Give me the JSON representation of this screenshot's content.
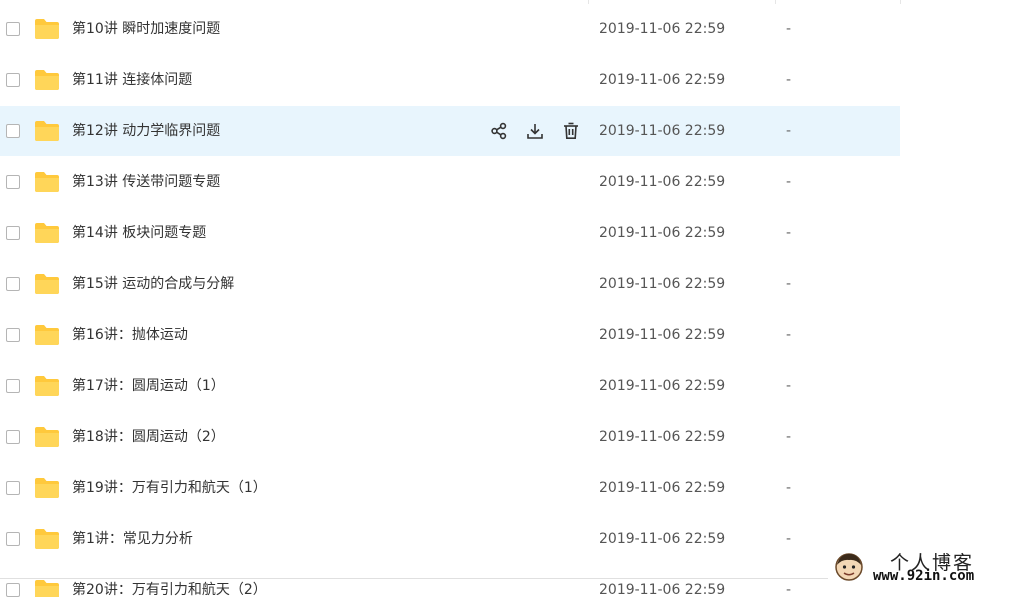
{
  "colors": {
    "folder": "#ffc93c",
    "hover_row": "#e8f5fd",
    "icon": "#333333"
  },
  "files": [
    {
      "name": "第10讲 瞬时加速度问题",
      "modified": "2019-11-06 22:59",
      "size": "-"
    },
    {
      "name": "第11讲 连接体问题",
      "modified": "2019-11-06 22:59",
      "size": "-"
    },
    {
      "name": "第12讲 动力学临界问题",
      "modified": "2019-11-06 22:59",
      "size": "-"
    },
    {
      "name": "第13讲 传送带问题专题",
      "modified": "2019-11-06 22:59",
      "size": "-"
    },
    {
      "name": "第14讲 板块问题专题",
      "modified": "2019-11-06 22:59",
      "size": "-"
    },
    {
      "name": "第15讲 运动的合成与分解",
      "modified": "2019-11-06 22:59",
      "size": "-"
    },
    {
      "name": "第16讲：抛体运动",
      "modified": "2019-11-06 22:59",
      "size": "-"
    },
    {
      "name": "第17讲：圆周运动（1）",
      "modified": "2019-11-06 22:59",
      "size": "-"
    },
    {
      "name": "第18讲：圆周运动（2）",
      "modified": "2019-11-06 22:59",
      "size": "-"
    },
    {
      "name": "第19讲：万有引力和航天（1）",
      "modified": "2019-11-06 22:59",
      "size": "-"
    },
    {
      "name": "第1讲：常见力分析",
      "modified": "2019-11-06 22:59",
      "size": "-"
    },
    {
      "name": "第20讲：万有引力和航天（2）",
      "modified": "2019-11-06 22:59",
      "size": "-"
    }
  ],
  "hover_actions": [
    "share-icon",
    "download-icon",
    "delete-icon"
  ],
  "watermark": {
    "title": "个人博客",
    "url": "www.92in.com"
  }
}
